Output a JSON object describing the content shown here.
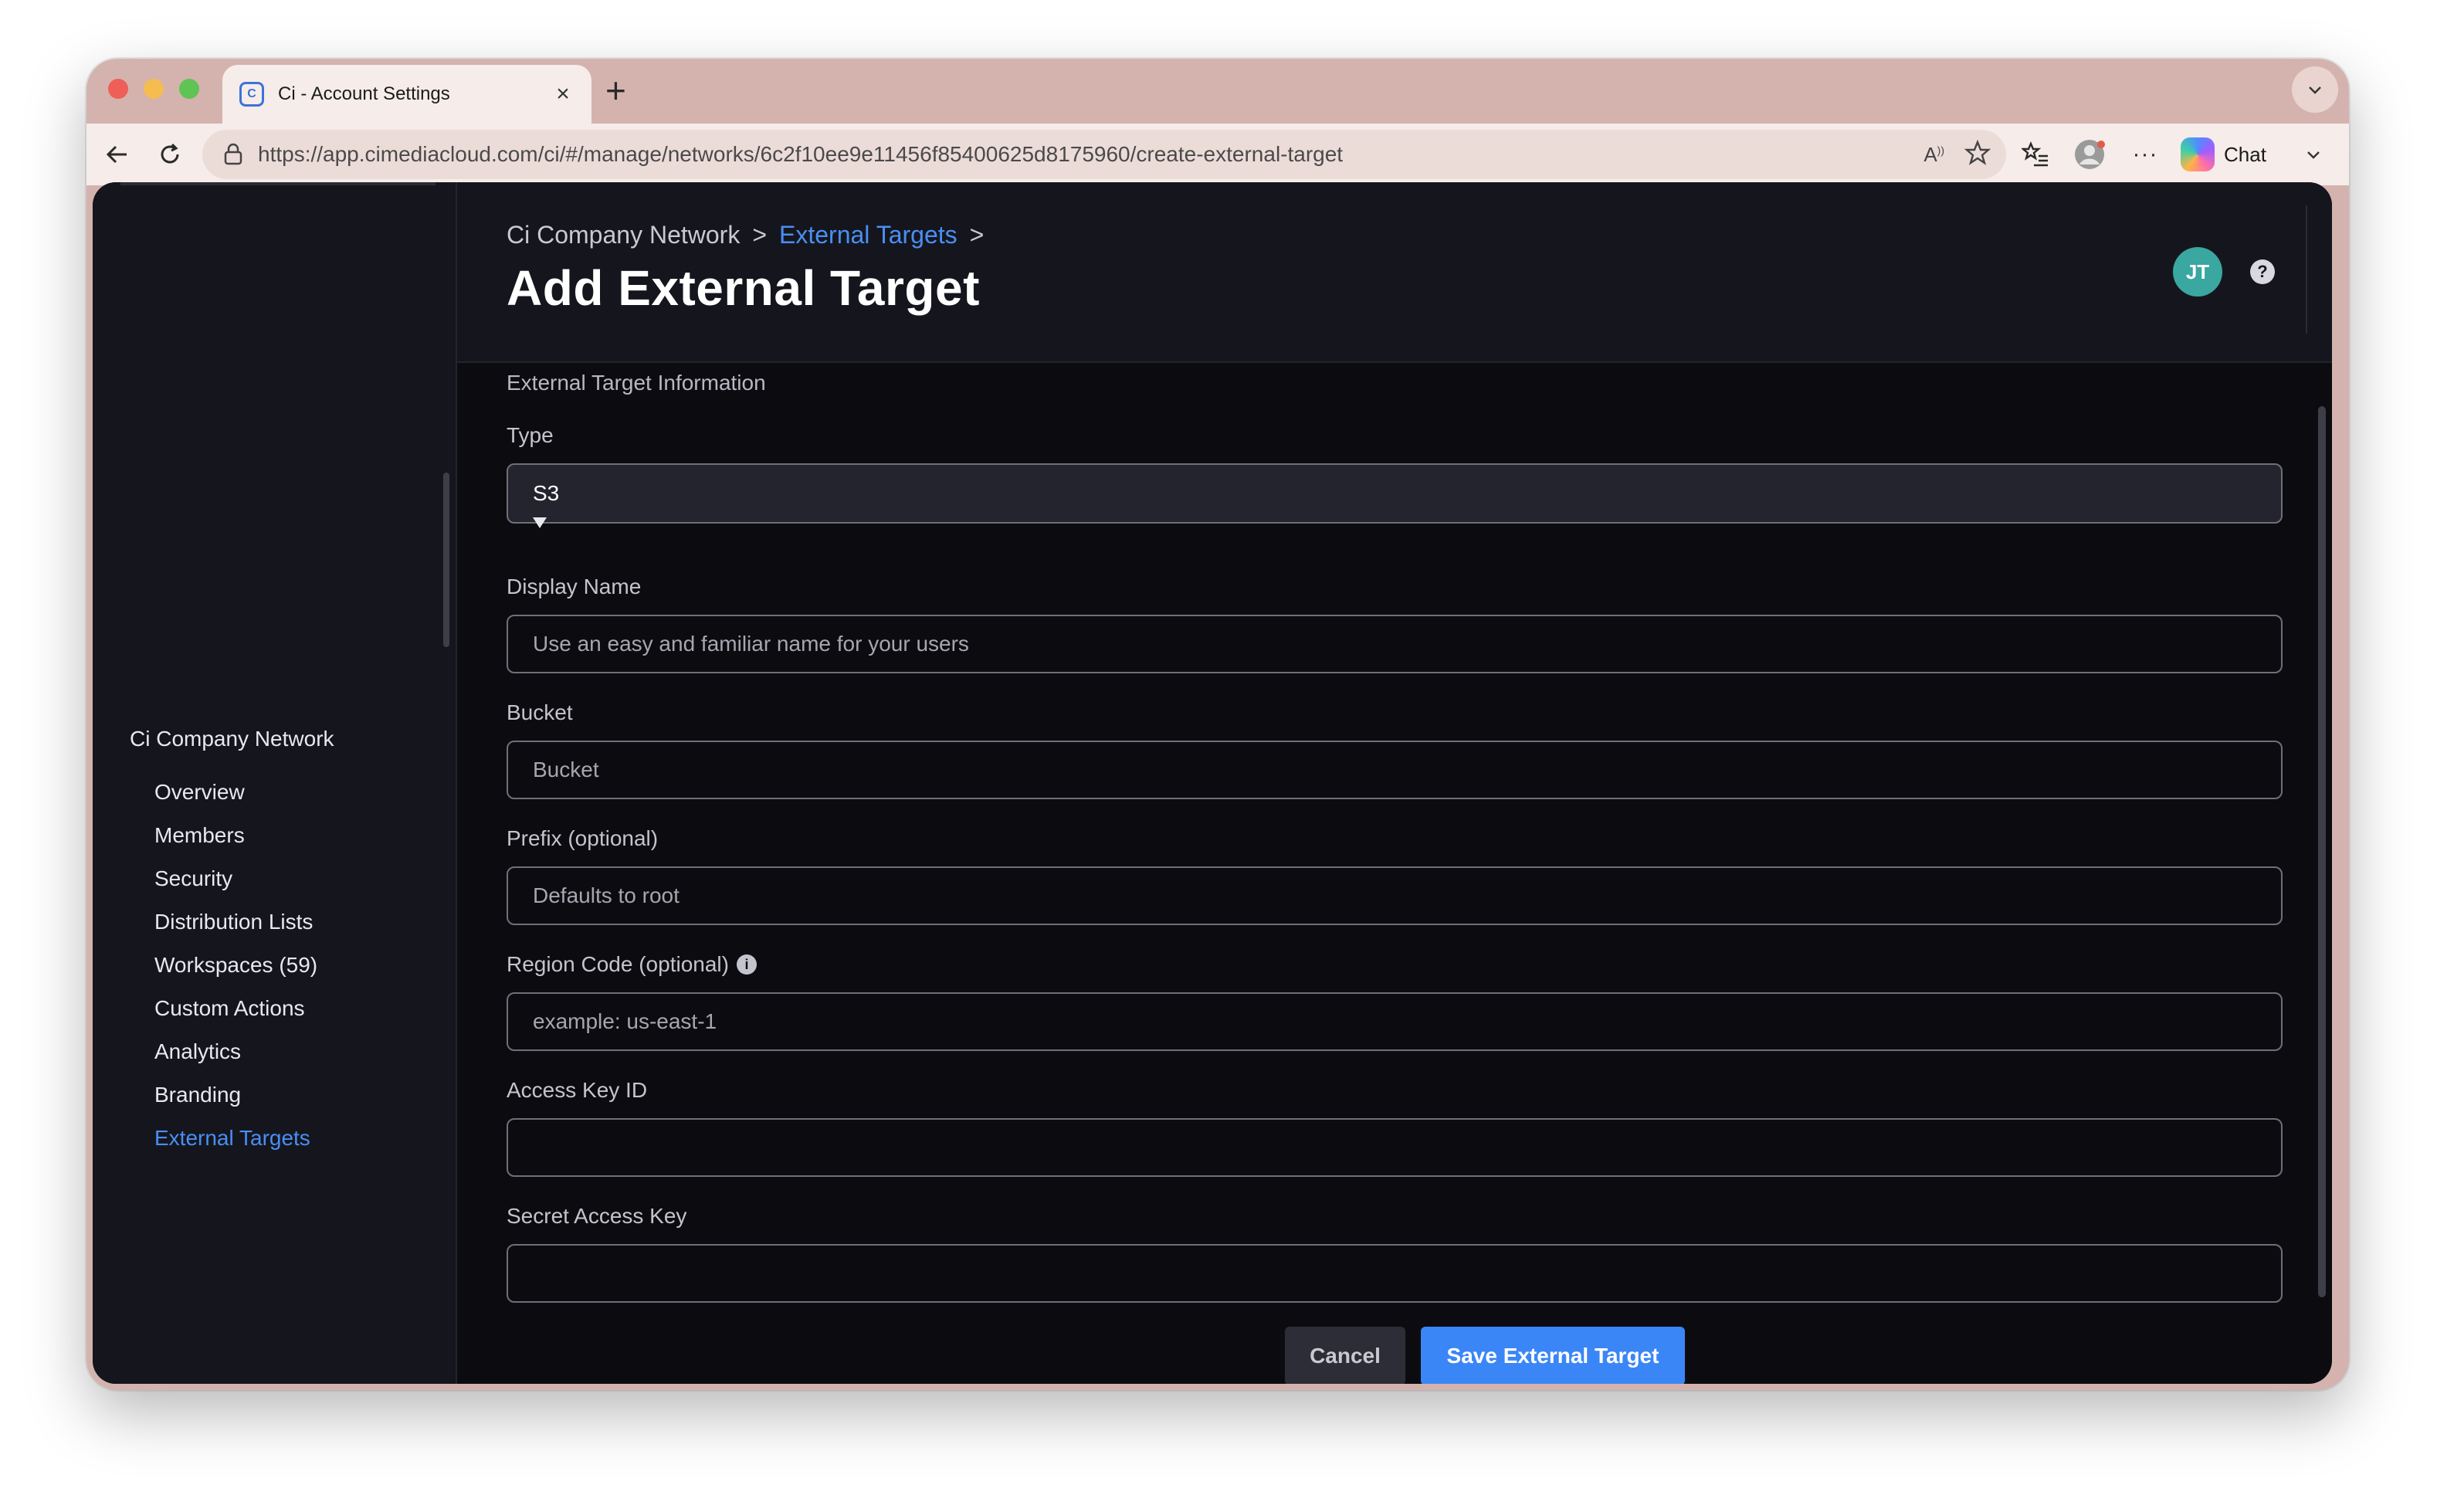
{
  "browser": {
    "tab_title": "Ci - Account Settings",
    "favicon": "C",
    "url": "https://app.cimediacloud.com/ci/#/manage/networks/6c2f10ee9e11456f85400625d8175960/create-external-target",
    "chat_label": "Chat"
  },
  "sidebar": {
    "heading": "Ci Company Network",
    "items": [
      {
        "label": "Overview"
      },
      {
        "label": "Members"
      },
      {
        "label": "Security"
      },
      {
        "label": "Distribution Lists"
      },
      {
        "label": "Workspaces (59)"
      },
      {
        "label": "Custom Actions"
      },
      {
        "label": "Analytics"
      },
      {
        "label": "Branding"
      },
      {
        "label": "External Targets"
      }
    ],
    "active_item": "External Targets"
  },
  "header": {
    "breadcrumb": [
      "Ci Company Network",
      ">",
      "External Targets",
      ">"
    ],
    "title": "Add External Target",
    "avatar_initials": "JT",
    "help_glyph": "?"
  },
  "form": {
    "section_title": "External Target Information",
    "type": {
      "label": "Type",
      "value": "S3"
    },
    "display_name": {
      "label": "Display Name",
      "placeholder": "Use an easy and familiar name for your users",
      "value": ""
    },
    "bucket": {
      "label": "Bucket",
      "placeholder": "Bucket",
      "value": ""
    },
    "prefix": {
      "label": "Prefix (optional)",
      "placeholder": "Defaults to root",
      "value": ""
    },
    "region": {
      "label": "Region Code (optional)",
      "placeholder": "example: us-east-1",
      "value": ""
    },
    "access_key": {
      "label": "Access Key ID",
      "placeholder": "",
      "value": ""
    },
    "secret_key": {
      "label": "Secret Access Key",
      "placeholder": "",
      "value": ""
    },
    "cancel_label": "Cancel",
    "save_label": "Save External Target"
  },
  "colors": {
    "accent": "#3b86f7",
    "background": "#0c0c10",
    "panel": "#15161d",
    "avatar": "#3aa7a0"
  }
}
